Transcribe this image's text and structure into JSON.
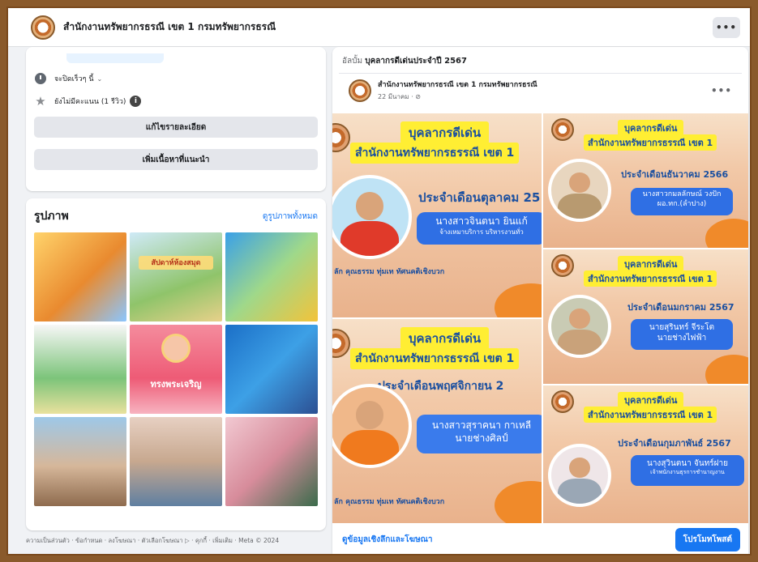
{
  "header": {
    "page_name": "สำนักงานทรัพยากรธรณี เขต 1 กรมทรัพยากรธรณี",
    "more_label": "•••"
  },
  "about": {
    "hours_text": "จะปิดเร็วๆ นี้",
    "rating_text": "ยังไม่มีคะแนน (1 รีวิว)",
    "info_badge": "i",
    "edit_details_label": "แก้ไขรายละเอียด",
    "add_featured_label": "เพิ่มเนื้อหาที่แนะนำ"
  },
  "photos": {
    "title": "รูปภาพ",
    "see_all_label": "ดูรูปภาพทั้งหมด",
    "tile_texts": {
      "t2_heading": "สัปดาห์ห้องสมุด",
      "t5_heading": "ทรงพระเจริญ"
    }
  },
  "footer": {
    "links_text": "ความเป็นส่วนตัว · ข้อกำหนด · ลงโฆษณา · ตัวเลือกโฆษณา ▷ · คุกกี้ · เพิ่มเติม · Meta © 2024"
  },
  "post": {
    "album_prefix": "อัลบั้ม",
    "album_name": "บุคลากรดีเด่นประจำปี 2567",
    "author": "สำนักงานทรัพยากรธรณี เขต 1 กรมทรัพยากรธรณี",
    "date": "22 มีนาคม · ⊘",
    "more_label": "•••",
    "detail_link": "ดูข้อมูลเชิงลึกและโฆษณา",
    "promote_label": "โปรโมทโพสต์"
  },
  "awards": [
    {
      "heading": "บุคลากรดีเด่น",
      "org": "สำนักงานทรัพยากรธรรณี เขต 1",
      "month": "ประจำเดือนตุลาคม 25",
      "name": "นางสาวจินตนา ยินแก้",
      "role": "จ้างเหมาบริการ บริหารงานทั่ว",
      "slogan": "ลัก คุณธรรม ทุ่มเท ทัศนคติเชิงบวก",
      "shirt_color": "#e03a2a"
    },
    {
      "heading": "บุคลากรดีเด่น",
      "org": "สำนักงานทรัพยากรธรรณี เขต 1",
      "month": "ประจำเดือนธันวาคม 2566",
      "name": "นางสาวกมลลักษณ์ วงปัก",
      "role": "ผอ.ทก.(ลำปาง)",
      "shirt_color": "#b89a70"
    },
    {
      "heading": "บุคลากรดีเด่น",
      "org": "สำนักงานทรัพยากรธรรณี เขต 1",
      "month": "ประจำเดือนมกราคม 2567",
      "name": "นายสุรินทร์ จีระโต",
      "role": "นายช่างไฟฟ้า",
      "shirt_color": "#c9a27a"
    },
    {
      "heading": "บุคลากรดีเด่น",
      "org": "สำนักงานทรัพยากรธรรณี เขต 1",
      "month": "ประจำเดือนพฤศจิกายน 2",
      "name": "นางสาวสุราคนา กาเหลี",
      "role": "นายช่างศิลป์",
      "slogan": "ลัก คุณธรรม ทุ่มเท ทัศนคติเชิงบวก",
      "shirt_color": "#f07a1e"
    },
    {
      "heading": "บุคลากรดีเด่น",
      "org": "สำนักงานทรัพยากรธรรณี เขต 1",
      "month": "ประจำเดือนกุมภาพันธ์ 2567",
      "name": "นางสุวินตนา จันทร์ฝาย",
      "role": "เจ้าพนักงานธุรการชำนาญงาน",
      "shirt_color": "#9aa7b5"
    }
  ]
}
